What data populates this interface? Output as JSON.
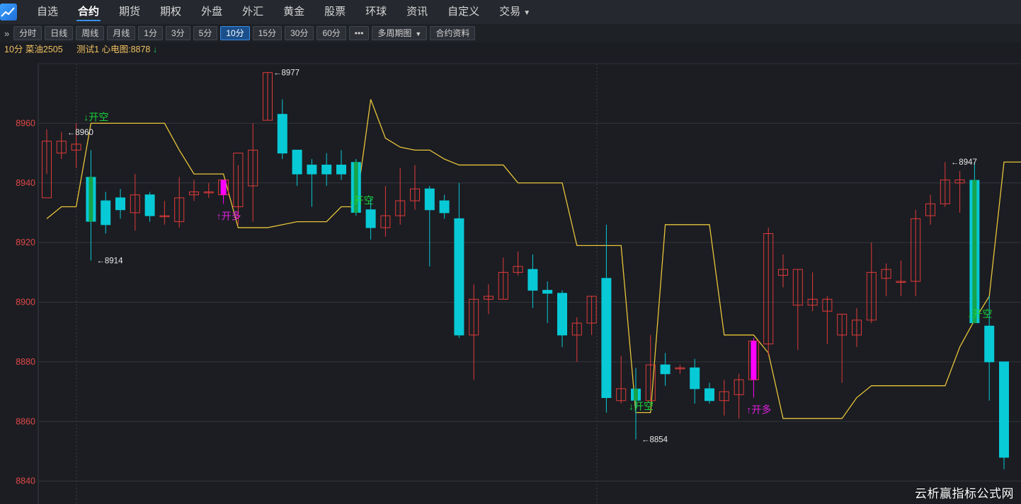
{
  "nav": {
    "items": [
      {
        "label": "自选"
      },
      {
        "label": "合约",
        "active": true
      },
      {
        "label": "期货"
      },
      {
        "label": "期权"
      },
      {
        "label": "外盘"
      },
      {
        "label": "外汇"
      },
      {
        "label": "黄金"
      },
      {
        "label": "股票"
      },
      {
        "label": "环球"
      },
      {
        "label": "资讯"
      },
      {
        "label": "自定义"
      },
      {
        "label": "交易",
        "dropdown": true
      }
    ]
  },
  "toolbar": {
    "expand_icon": "»",
    "buttons": [
      {
        "label": "分时"
      },
      {
        "label": "日线"
      },
      {
        "label": "周线"
      },
      {
        "label": "月线"
      },
      {
        "label": "1分"
      },
      {
        "label": "3分"
      },
      {
        "label": "5分"
      },
      {
        "label": "10分",
        "active": true
      },
      {
        "label": "15分"
      },
      {
        "label": "30分"
      },
      {
        "label": "60分"
      },
      {
        "label": "•••"
      },
      {
        "label": "多周期图",
        "dropdown": true
      },
      {
        "label": "合约资料"
      }
    ]
  },
  "info": {
    "title": "10分 菜油2505",
    "indicator_label": "测试1 心电图:8878",
    "indicator_direction": "down"
  },
  "watermark": "云析赢指标公式网",
  "colors": {
    "up": "#e03a3a",
    "down": "#08c9d6",
    "signal_line": "#e8c43a",
    "grid": "#33363c",
    "axis_text": "#e04848",
    "open_short": "#19d13a",
    "open_long": "#e020e0",
    "green_highlight": "#16a34a",
    "magenta_highlight": "#ff00ff"
  },
  "chart_data": {
    "type": "candlestick",
    "y_ticks": [
      8960,
      8940,
      8920,
      8900,
      8880,
      8860,
      8840
    ],
    "ylim": [
      8834,
      8980
    ],
    "candles": [
      {
        "o": 8935,
        "h": 8958,
        "l": 8943,
        "c": 8954
      },
      {
        "o": 8950,
        "h": 8957,
        "l": 8948,
        "c": 8954
      },
      {
        "o": 8951,
        "h": 8960,
        "l": 8945,
        "c": 8953
      },
      {
        "o": 8942,
        "h": 8951,
        "l": 8914,
        "c": 8927,
        "hl": "green"
      },
      {
        "o": 8934,
        "h": 8937,
        "l": 8923,
        "c": 8926
      },
      {
        "o": 8935,
        "h": 8938,
        "l": 8928,
        "c": 8931
      },
      {
        "o": 8930,
        "h": 8943,
        "l": 8924,
        "c": 8936
      },
      {
        "o": 8936,
        "h": 8937,
        "l": 8927,
        "c": 8929
      },
      {
        "o": 8929,
        "h": 8934,
        "l": 8926,
        "c": 8929
      },
      {
        "o": 8927,
        "h": 8942,
        "l": 8925,
        "c": 8935
      },
      {
        "o": 8936,
        "h": 8941,
        "l": 8934,
        "c": 8937
      },
      {
        "o": 8937,
        "h": 8940,
        "l": 8935,
        "c": 8937
      },
      {
        "o": 8936,
        "h": 8941,
        "l": 8933,
        "c": 8941,
        "hl": "magenta"
      },
      {
        "o": 8932,
        "h": 8946,
        "l": 8926,
        "c": 8950
      },
      {
        "o": 8939,
        "h": 8960,
        "l": 8927,
        "c": 8951
      },
      {
        "o": 8961,
        "h": 8977,
        "l": 8961,
        "c": 8977
      },
      {
        "o": 8963,
        "h": 8968,
        "l": 8948,
        "c": 8950
      },
      {
        "o": 8951,
        "h": 8951,
        "l": 8939,
        "c": 8943
      },
      {
        "o": 8946,
        "h": 8948,
        "l": 8932,
        "c": 8943
      },
      {
        "o": 8946,
        "h": 8950,
        "l": 8939,
        "c": 8943
      },
      {
        "o": 8946,
        "h": 8951,
        "l": 8941,
        "c": 8943
      },
      {
        "o": 8947,
        "h": 8948,
        "l": 8929,
        "c": 8930,
        "hl": "green"
      },
      {
        "o": 8931,
        "h": 8935,
        "l": 8921,
        "c": 8925
      },
      {
        "o": 8925,
        "h": 8939,
        "l": 8922,
        "c": 8929
      },
      {
        "o": 8929,
        "h": 8945,
        "l": 8926,
        "c": 8934
      },
      {
        "o": 8934,
        "h": 8946,
        "l": 8931,
        "c": 8938
      },
      {
        "o": 8938,
        "h": 8939,
        "l": 8912,
        "c": 8931
      },
      {
        "o": 8934,
        "h": 8936,
        "l": 8928,
        "c": 8930
      },
      {
        "o": 8928,
        "h": 8940,
        "l": 8888,
        "c": 8889
      },
      {
        "o": 8889,
        "h": 8906,
        "l": 8874,
        "c": 8901
      },
      {
        "o": 8901,
        "h": 8906,
        "l": 8896,
        "c": 8902
      },
      {
        "o": 8901,
        "h": 8915,
        "l": 8901,
        "c": 8910
      },
      {
        "o": 8910,
        "h": 8917,
        "l": 8909,
        "c": 8912
      },
      {
        "o": 8911,
        "h": 8916,
        "l": 8898,
        "c": 8904
      },
      {
        "o": 8904,
        "h": 8907,
        "l": 8893,
        "c": 8903
      },
      {
        "o": 8903,
        "h": 8904,
        "l": 8885,
        "c": 8889
      },
      {
        "o": 8889,
        "h": 8895,
        "l": 8880,
        "c": 8893
      },
      {
        "o": 8893,
        "h": 8902,
        "l": 8889,
        "c": 8902
      },
      {
        "o": 8908,
        "h": 8926,
        "l": 8863,
        "c": 8868
      },
      {
        "o": 8867,
        "h": 8882,
        "l": 8866,
        "c": 8871
      },
      {
        "o": 8871,
        "h": 8878,
        "l": 8854,
        "c": 8867,
        "hl": "green"
      },
      {
        "o": 8867,
        "h": 8889,
        "l": 8867,
        "c": 8879
      },
      {
        "o": 8879,
        "h": 8883,
        "l": 8872,
        "c": 8876
      },
      {
        "o": 8878,
        "h": 8879,
        "l": 8876,
        "c": 8878
      },
      {
        "o": 8878,
        "h": 8881,
        "l": 8866,
        "c": 8871
      },
      {
        "o": 8871,
        "h": 8873,
        "l": 8866,
        "c": 8867
      },
      {
        "o": 8867,
        "h": 8874,
        "l": 8862,
        "c": 8870
      },
      {
        "o": 8869,
        "h": 8876,
        "l": 8861,
        "c": 8874
      },
      {
        "o": 8874,
        "h": 8888,
        "l": 8868,
        "c": 8887,
        "hl": "magenta"
      },
      {
        "o": 8886,
        "h": 8925,
        "l": 8882,
        "c": 8923
      },
      {
        "o": 8909,
        "h": 8916,
        "l": 8905,
        "c": 8911
      },
      {
        "o": 8899,
        "h": 8911,
        "l": 8884,
        "c": 8911
      },
      {
        "o": 8899,
        "h": 8910,
        "l": 8897,
        "c": 8901
      },
      {
        "o": 8897,
        "h": 8902,
        "l": 8886,
        "c": 8901
      },
      {
        "o": 8889,
        "h": 8896,
        "l": 8873,
        "c": 8896
      },
      {
        "o": 8889,
        "h": 8898,
        "l": 8885,
        "c": 8894
      },
      {
        "o": 8894,
        "h": 8920,
        "l": 8893,
        "c": 8910
      },
      {
        "o": 8908,
        "h": 8913,
        "l": 8902,
        "c": 8911
      },
      {
        "o": 8907,
        "h": 8914,
        "l": 8902,
        "c": 8907
      },
      {
        "o": 8907,
        "h": 8931,
        "l": 8902,
        "c": 8928
      },
      {
        "o": 8929,
        "h": 8936,
        "l": 8926,
        "c": 8933
      },
      {
        "o": 8933,
        "h": 8947,
        "l": 8932,
        "c": 8941
      },
      {
        "o": 8940,
        "h": 8944,
        "l": 8930,
        "c": 8941
      },
      {
        "o": 8941,
        "h": 8947,
        "l": 8893,
        "c": 8893,
        "hl": "green"
      },
      {
        "o": 8892,
        "h": 8902,
        "l": 8867,
        "c": 8880
      },
      {
        "o": 8880,
        "h": 8880,
        "l": 8844,
        "c": 8848
      }
    ],
    "signal_line": [
      8928,
      8932,
      8932,
      8960,
      8960,
      8960,
      8960,
      8960,
      8960,
      8951,
      8943,
      8943,
      8943,
      8925,
      8925,
      8925,
      8926,
      8927,
      8927,
      8927,
      8932,
      8932,
      8968,
      8955,
      8952,
      8951,
      8951,
      8948,
      8946,
      8946,
      8946,
      8946,
      8940,
      8940,
      8940,
      8940,
      8919,
      8919,
      8919,
      8919,
      8863,
      8863,
      8926,
      8926,
      8926,
      8926,
      8889,
      8889,
      8889,
      8883,
      8861,
      8861,
      8861,
      8861,
      8861,
      8868,
      8872,
      8872,
      8872,
      8872,
      8872,
      8872,
      8885,
      8894,
      8902,
      8947,
      8947,
      8947,
      8947,
      8947
    ],
    "price_labels": [
      {
        "idx": 1,
        "value": 8960,
        "pos": "high"
      },
      {
        "idx": 3,
        "value": 8914,
        "pos": "low"
      },
      {
        "idx": 15,
        "value": 8977,
        "pos": "high"
      },
      {
        "idx": 40,
        "value": 8854,
        "pos": "low"
      },
      {
        "idx": 61,
        "value": 8947,
        "pos": "high"
      }
    ],
    "signals": [
      {
        "idx": 3,
        "text": "↓开空",
        "type": "short"
      },
      {
        "idx": 12,
        "text": "↑开多",
        "type": "long"
      },
      {
        "idx": 21,
        "text": "↓开空",
        "type": "short"
      },
      {
        "idx": 40,
        "text": "↓开空",
        "type": "short"
      },
      {
        "idx": 48,
        "text": "↑开多",
        "type": "long"
      },
      {
        "idx": 63,
        "text": "↓开空",
        "type": "short"
      }
    ]
  }
}
